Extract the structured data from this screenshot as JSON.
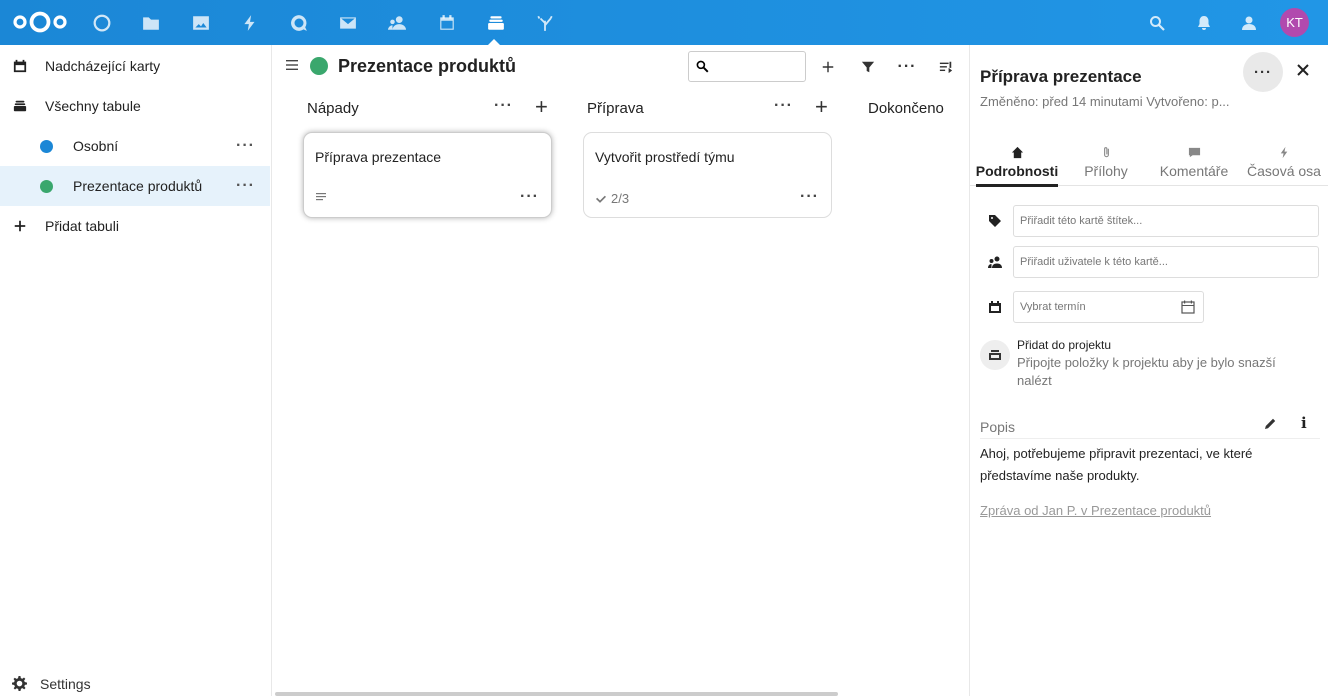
{
  "header": {
    "apps": [
      "dashboard-icon",
      "files-icon",
      "photos-icon",
      "activity-icon",
      "talk-icon",
      "mail-icon",
      "contacts-icon",
      "calendar-icon",
      "deck-icon",
      "flow-icon"
    ],
    "avatar_initials": "KT",
    "colors": {
      "header_bg": "#1b87d6",
      "avatar_bg": "#b14aae"
    }
  },
  "leftnav": {
    "items": [
      {
        "label": "Nadcházející karty",
        "icon": "calendar-icon"
      },
      {
        "label": "Všechny tabule",
        "icon": "archive-icon"
      },
      {
        "label": "Osobní",
        "color": "#1b87d6"
      },
      {
        "label": "Prezentace produktů",
        "color": "#3aa76d"
      },
      {
        "label": "Přidat tabuli",
        "icon": "plus-icon"
      }
    ],
    "settings_label": "Settings"
  },
  "board": {
    "title": "Prezentace produktů",
    "color": "#3aa76d",
    "stacks": [
      {
        "title": "Nápady",
        "cards": [
          {
            "title": "Příprava prezentace",
            "badge": ""
          }
        ]
      },
      {
        "title": "Příprava",
        "cards": [
          {
            "title": "Vytvořit prostředí týmu",
            "badge": "2/3"
          }
        ]
      },
      {
        "title": "Dokončeno",
        "cards": []
      }
    ]
  },
  "sidebar": {
    "title": "Příprava prezentace",
    "subtitle": "Změněno: před 14 minutami Vytvořeno: p...",
    "tabs": [
      "Podrobnosti",
      "Přílohy",
      "Komentáře",
      "Časová osa"
    ],
    "active_tab": "Podrobnosti",
    "tags_placeholder": "Přiřadit této kartě štítek...",
    "users_placeholder": "Přiřadit uživatele k této kartě...",
    "due_placeholder": "Vybrat termín",
    "project_title": "Přidat do projektu",
    "project_desc": "Připojte položky k projektu aby je bylo snazší nalézt",
    "description_label": "Popis",
    "description_text": "Ahoj, potřebujeme připravit prezentaci, ve které představíme naše produkty.",
    "description_link": "Zpráva od Jan P. v Prezentace produktů"
  }
}
